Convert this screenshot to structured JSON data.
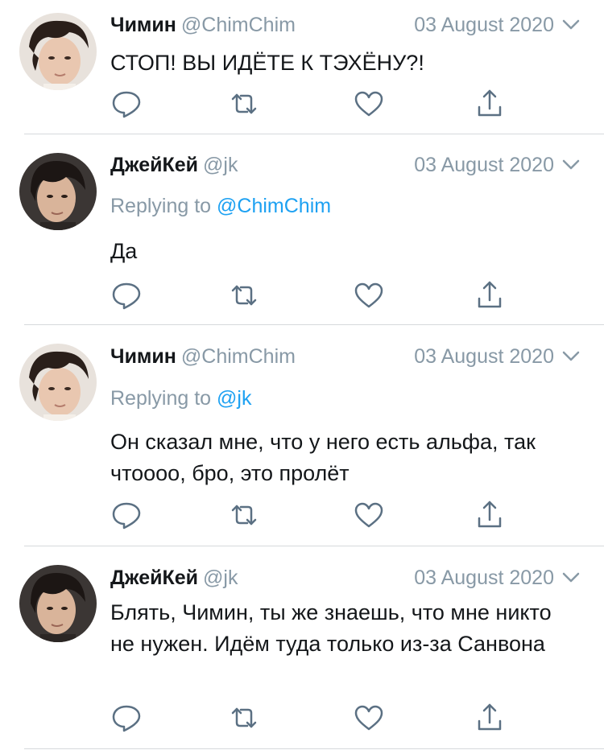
{
  "colors": {
    "text": "#14171a",
    "muted": "#8899a6",
    "mention": "#1da1f2",
    "divider": "#d6d9dc",
    "icon": "#5b7083"
  },
  "tweets": [
    {
      "name": "Чимин",
      "handle": "@ChimChim",
      "date": "03 August 2020",
      "text": "СТОП! ВЫ ИДЁТЕ К ТЭХЁНУ?!",
      "avatar": "jimin-avatar"
    },
    {
      "name": "ДжейКей",
      "handle": "@jk",
      "date": "03 August 2020",
      "replying_prefix": "Replying to",
      "replying_to": "@ChimChim",
      "text": "Да",
      "avatar": "jk-avatar"
    },
    {
      "name": "Чимин",
      "handle": "@ChimChim",
      "date": "03 August 2020",
      "replying_prefix": "Replying to",
      "replying_to": "@jk",
      "text": "Он сказал мне, что у него есть альфа, так чтоооо, бро, это пролёт",
      "avatar": "jimin-avatar"
    },
    {
      "name": "ДжейКей",
      "handle": "@jk",
      "date": "03 August 2020",
      "text": "Блять, Чимин, ты же знаешь, что мне никто не нужен. Идём туда только из-за Санвона",
      "avatar": "jk-avatar"
    }
  ],
  "icons": [
    "reply-icon",
    "retweet-icon",
    "like-icon",
    "share-icon",
    "chevron-down-icon"
  ]
}
